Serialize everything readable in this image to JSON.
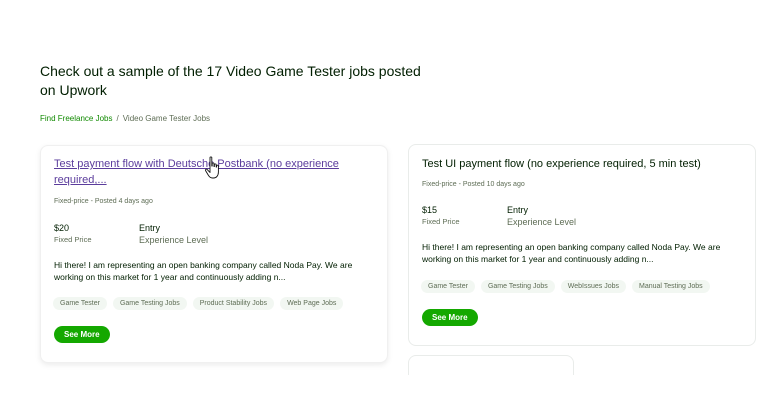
{
  "heading": "Check out a sample of the 17 Video Game Tester jobs posted on Upwork",
  "breadcrumb": {
    "link": "Find Freelance Jobs",
    "separator": "/",
    "current": "Video Game Tester Jobs"
  },
  "jobs": [
    {
      "title": "Test payment flow with Deutsche Postbank (no experience required,...",
      "type": "Fixed-price",
      "posted": "Posted 4 days ago",
      "price": "$20",
      "price_label": "Fixed Price",
      "level": "Entry",
      "level_label": "Experience Level",
      "description": "Hi there! I am representing an open banking company called Noda Pay. We are working on this market for 1 year and continuously adding n...",
      "tags": [
        "Game Tester",
        "Game Testing Jobs",
        "Product Stability Jobs",
        "Web Page Jobs"
      ],
      "button": "See More"
    },
    {
      "title": "Test UI payment flow (no experience required, 5 min test)",
      "type": "Fixed-price",
      "posted": "Posted 10 days ago",
      "price": "$15",
      "price_label": "Fixed Price",
      "level": "Entry",
      "level_label": "Experience Level",
      "description": "Hi there! I am representing an open banking company called Noda Pay. We are working on this market for 1 year and continuously adding n...",
      "tags": [
        "Game Tester",
        "Game Testing Jobs",
        "WebIssues Jobs",
        "Manual Testing Jobs"
      ],
      "button": "See More"
    }
  ],
  "meta_separator": " - ",
  "colors": {
    "accent": "#14a800",
    "link_visited": "#5b3c9c",
    "text": "#001e00",
    "muted": "#5e6d55"
  },
  "cursor_icon": "hand-pointer-icon"
}
